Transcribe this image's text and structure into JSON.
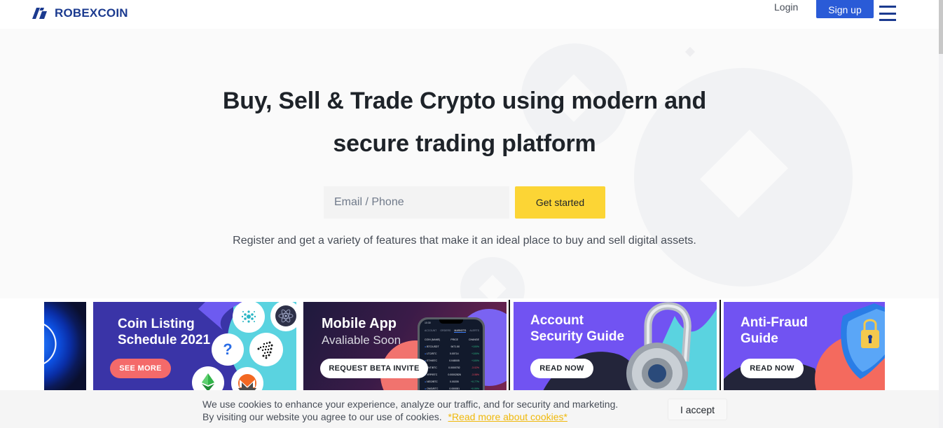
{
  "header": {
    "brand": "ROBEXCOIN",
    "login_label": "Login",
    "signup_label": "Sign up",
    "menu_icon": "hamburger-menu-icon",
    "brand_color": "#1b3a8f",
    "signup_color": "#2a5bd7"
  },
  "hero": {
    "title_line1": "Buy, Sell & Trade Crypto using modern and",
    "title_line2": "secure trading platform",
    "email_placeholder": "Email / Phone",
    "email_value": "",
    "cta_label": "Get started",
    "cta_color": "#fcd535",
    "subtitle": "Register and get a variety of features that make it an ideal place to buy and sell digital assets."
  },
  "banners": [
    {
      "name": "partial-banner",
      "title": ""
    },
    {
      "name": "coin-listing",
      "title_line1": "Coin Listing",
      "title_line2": "Schedule 2021",
      "button": "SEE MORE",
      "coins": [
        "cardano-icon",
        "cosmos-icon",
        "question-mark-icon",
        "iota-icon",
        "ethereum-classic-icon",
        "monero-icon"
      ]
    },
    {
      "name": "mobile-app",
      "title_line1": "Mobile App",
      "title_line2": "Avaliable Soon",
      "button": "REQUEST BETA INVITE",
      "phone": {
        "time": "10:30",
        "tabs": [
          "ACCOUNT",
          "ORDERS",
          "MARKETS",
          "ALERTS"
        ],
        "active_tab": "MARKETS",
        "columns": [
          "COIN (NAME)",
          "PRICE",
          "CHANGE"
        ],
        "rows": [
          {
            "coin": "BTC/USDT",
            "price": "9471.50",
            "change": "+100%",
            "up": true
          },
          {
            "coin": "LTC/BTC",
            "price": "0.00714",
            "change": "+100%",
            "up": true
          },
          {
            "coin": "ETH/BTC",
            "price": "0.048005",
            "change": "+100%",
            "up": true
          },
          {
            "coin": "TNT/BTC",
            "price": "0.0000752",
            "change": "-3.02%",
            "up": false
          },
          {
            "coin": "XRP/BTC",
            "price": "0.00002826",
            "change": "-3.08%",
            "up": false
          },
          {
            "coin": "NEO/BTC",
            "price": "0.00205",
            "change": "+0.77%",
            "up": true
          },
          {
            "coin": "OMG/BTC",
            "price": "0.000081",
            "change": "+0.09%",
            "up": true
          }
        ]
      }
    },
    {
      "name": "account-security",
      "title_line1": "Account",
      "title_line2": "Security Guide",
      "button": "READ NOW"
    },
    {
      "name": "anti-fraud",
      "title_line1": "Anti-Fraud",
      "title_line2": "Guide",
      "button": "READ NOW"
    }
  ],
  "cookie": {
    "line1": "We use cookies to enhance your experience, analyze our traffic, and for security and marketing.",
    "line2": "By visiting our website you agree to our use of cookies.",
    "link": "*Read more about cookies*",
    "accept_label": "I accept",
    "link_color": "#f0b90b"
  }
}
